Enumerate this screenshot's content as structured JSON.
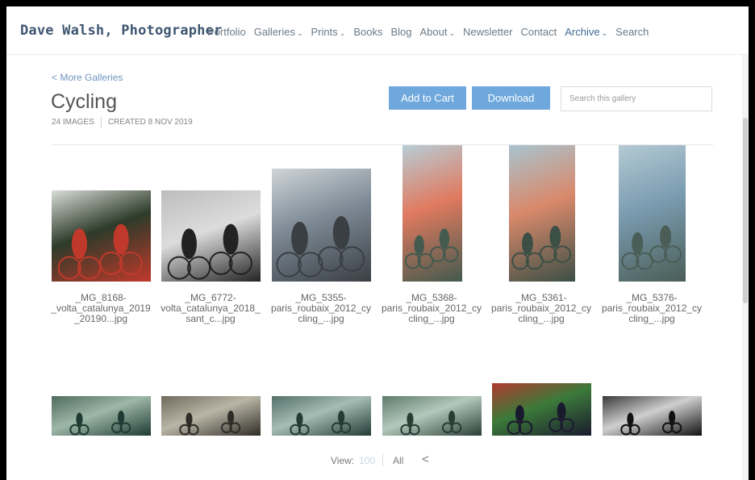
{
  "header": {
    "brand": "Dave Walsh, Photographer",
    "nav": [
      {
        "label": "Portfolio",
        "caret": false,
        "active": false
      },
      {
        "label": "Galleries",
        "caret": true,
        "active": false
      },
      {
        "label": "Prints",
        "caret": true,
        "active": false
      },
      {
        "label": "Books",
        "caret": false,
        "active": false
      },
      {
        "label": "Blog",
        "caret": false,
        "active": false
      },
      {
        "label": "About",
        "caret": true,
        "active": false
      },
      {
        "label": "Newsletter",
        "caret": false,
        "active": false
      },
      {
        "label": "Contact",
        "caret": false,
        "active": false
      },
      {
        "label": "Archive",
        "caret": true,
        "active": true
      },
      {
        "label": "Search",
        "caret": false,
        "active": false
      }
    ],
    "caret_glyph": "⌄"
  },
  "gallery": {
    "back_link": "< More Galleries",
    "title": "Cycling",
    "image_count": "24 IMAGES",
    "created": "CREATED 8 NOV 2019",
    "add_to_cart": "Add to Cart",
    "download": "Download",
    "search_placeholder": "Search this gallery"
  },
  "images_row1": [
    {
      "caption": "_MG_8168-\n_volta_catalunya_2019\n_20190...jpg",
      "palette": [
        "#d9ded8",
        "#c0392b",
        "#2d3b2a"
      ]
    },
    {
      "caption": "_MG_6772-\nvolta_catalunya_2018_\nsant_c...jpg",
      "palette": [
        "#bdbdbd",
        "#222222",
        "#dcdcdc"
      ]
    },
    {
      "caption": "_MG_5355-\nparis_roubaix_2012_cy\ncling_...jpg",
      "palette": [
        "#cfd5d9",
        "#3a3f44",
        "#7d8a95"
      ]
    },
    {
      "caption": "_MG_5368-\nparis_roubaix_2012_cy\ncling_...jpg",
      "palette": [
        "#b7cdd6",
        "#435a4e",
        "#e07a5f"
      ]
    },
    {
      "caption": "_MG_5361-\nparis_roubaix_2012_cy\ncling_...jpg",
      "palette": [
        "#a8c4cf",
        "#3b4f45",
        "#d9896b"
      ]
    },
    {
      "caption": "_MG_5376-\nparis_roubaix_2012_cy\ncling_...jpg",
      "palette": [
        "#b4cad4",
        "#4a5e57",
        "#7a9bb0"
      ]
    }
  ],
  "images_row2": [
    {
      "palette": [
        "#4f6b5e",
        "#1f3a33",
        "#9db7a8"
      ]
    },
    {
      "palette": [
        "#6e6a5c",
        "#2e2c26",
        "#b9b6a6"
      ]
    },
    {
      "palette": [
        "#54706a",
        "#243a35",
        "#a5bdb4"
      ]
    },
    {
      "palette": [
        "#5d7a6b",
        "#2a3d34",
        "#b3c8bc"
      ]
    },
    {
      "palette": [
        "#b03a2e",
        "#1a1a2e",
        "#3c7a3a"
      ]
    },
    {
      "palette": [
        "#3a3a3a",
        "#111111",
        "#cfcfcf"
      ]
    }
  ],
  "footer": {
    "view_label": "View:",
    "view_count": "100",
    "view_all": "All",
    "share_icon": "<"
  }
}
